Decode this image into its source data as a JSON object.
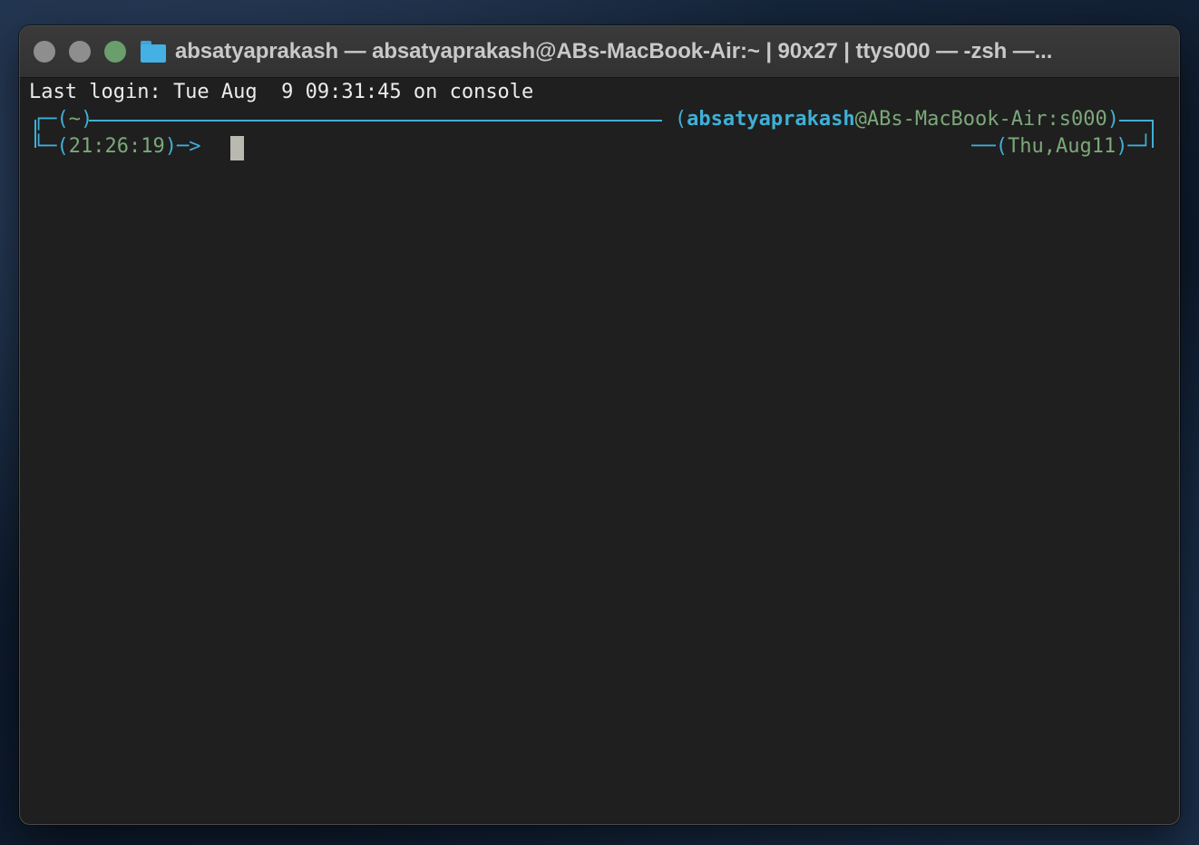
{
  "window": {
    "title": "absatyaprakash — absatyaprakash@ABs-MacBook-Air:~ | 90x27 | ttys000 — -zsh —..."
  },
  "terminal": {
    "last_login": "Last login: Tue Aug  9 09:31:45 on console",
    "prompt": {
      "cwd": "~",
      "user": "absatyaprakash",
      "host_tty": "ABs-MacBook-Air:s000",
      "time": "21:26:19",
      "date": "Thu,Aug11"
    }
  },
  "colors": {
    "accent": "#3fb0d6",
    "secondary": "#7ca87a",
    "background": "#1f1f1f",
    "text": "#ececec"
  },
  "icons": {
    "folder": "folder-icon",
    "cursor": "block-cursor"
  }
}
